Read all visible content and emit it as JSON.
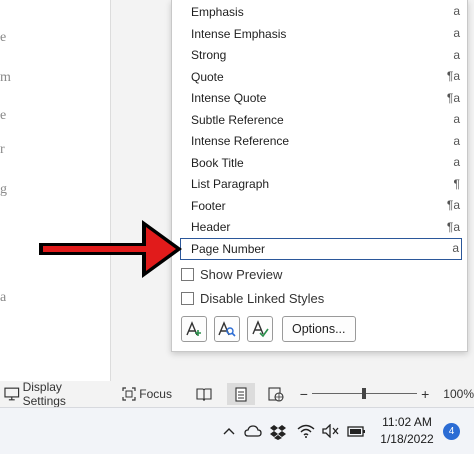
{
  "document": {
    "fragments": [
      "e",
      "m",
      "e",
      "r",
      "g",
      "a"
    ]
  },
  "styles_pane": {
    "styles": [
      {
        "name": "Emphasis",
        "type_mark": "a"
      },
      {
        "name": "Intense Emphasis",
        "type_mark": "a"
      },
      {
        "name": "Strong",
        "type_mark": "a"
      },
      {
        "name": "Quote",
        "type_mark": "¶a"
      },
      {
        "name": "Intense Quote",
        "type_mark": "¶a"
      },
      {
        "name": "Subtle Reference",
        "type_mark": "a"
      },
      {
        "name": "Intense Reference",
        "type_mark": "a"
      },
      {
        "name": "Book Title",
        "type_mark": "a"
      },
      {
        "name": "List Paragraph",
        "type_mark": "¶"
      },
      {
        "name": "Footer",
        "type_mark": "¶a"
      },
      {
        "name": "Header",
        "type_mark": "¶a"
      },
      {
        "name": "Page Number",
        "type_mark": "a",
        "selected": true
      }
    ],
    "show_preview_label": "Show Preview",
    "show_preview_checked": false,
    "disable_linked_label": "Disable Linked Styles",
    "disable_linked_checked": false,
    "new_style_icon": "new-style-icon",
    "style_inspector_icon": "style-inspector-icon",
    "manage_styles_icon": "manage-styles-icon",
    "options_label": "Options..."
  },
  "annotation": {
    "arrow_color": "#e11b1b",
    "points_to": "Page Number"
  },
  "status_bar": {
    "display_settings_label": "Display Settings",
    "focus_label": "Focus",
    "views": [
      "read-mode-icon",
      "print-layout-icon",
      "web-layout-icon"
    ],
    "active_view": "print-layout-icon",
    "zoom_out_label": "−",
    "zoom_in_label": "+",
    "zoom_level": "100%",
    "zoom_fraction": 0.5
  },
  "taskbar": {
    "tray_icons": [
      "chevron-up-icon",
      "onedrive-cloud-icon",
      "dropbox-icon",
      "wifi-icon",
      "volume-muted-icon",
      "battery-icon"
    ],
    "time": "11:02 AM",
    "date": "1/18/2022",
    "notification_count": "4",
    "accent_color": "#2b6cd4"
  }
}
